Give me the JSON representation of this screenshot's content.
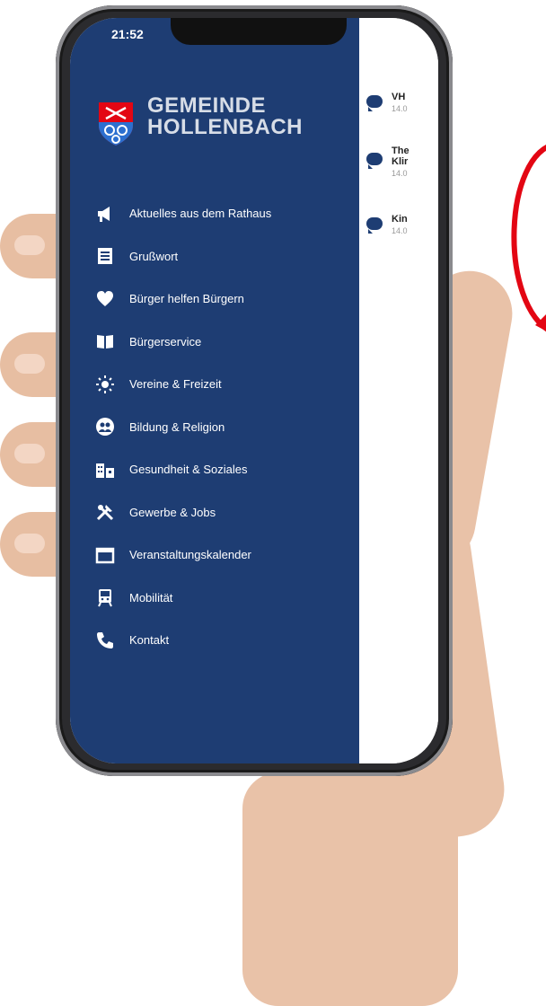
{
  "status": {
    "time": "21:52"
  },
  "app": {
    "title_line1": "GEMEINDE",
    "title_line2": "HOLLENBACH"
  },
  "menu": [
    {
      "label": "Aktuelles aus dem Rathaus",
      "icon": "megaphone-icon"
    },
    {
      "label": "Grußwort",
      "icon": "document-icon"
    },
    {
      "label": "Bürger helfen Bürgern",
      "icon": "heart-icon"
    },
    {
      "label": "Bürgerservice",
      "icon": "book-icon"
    },
    {
      "label": "Vereine & Freizeit",
      "icon": "sun-icon"
    },
    {
      "label": "Bildung & Religion",
      "icon": "people-icon"
    },
    {
      "label": "Gesundheit & Soziales",
      "icon": "buildings-icon"
    },
    {
      "label": "Gewerbe & Jobs",
      "icon": "tools-icon"
    },
    {
      "label": "Veranstaltungskalender",
      "icon": "calendar-icon"
    },
    {
      "label": "Mobilität",
      "icon": "train-icon"
    },
    {
      "label": "Kontakt",
      "icon": "phone-icon"
    }
  ],
  "content": {
    "items": [
      {
        "title": "VH",
        "date": "14.0"
      },
      {
        "title": "The",
        "title2": "Klir",
        "date": "14.0"
      },
      {
        "title": "Kin",
        "date": "14.0"
      }
    ]
  },
  "colors": {
    "drawer": "#1e3d73",
    "accent": "#e30613"
  }
}
